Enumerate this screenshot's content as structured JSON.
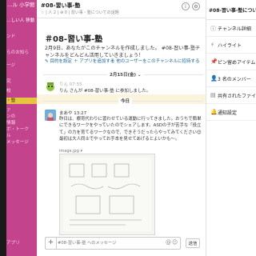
{
  "sidebar": {
    "workspace": "…ル 小学館 ",
    "items": [
      "…しい人 移動",
      "ンド",
      "らのお知ら",
      "ージ",
      "究",
      "校",
      "・塾",
      "ァ",
      "ンの",
      "情報",
      "ボ・トーク",
      "ル",
      "メッセージ",
      "",
      "",
      "",
      "",
      "アプリ"
    ]
  },
  "channel": {
    "name": "#08-習い事-塾",
    "meta": "☆ | 人 2 | ⊕ 0 | 習い事・塾についての話題"
  },
  "intro": {
    "title": "＃08-習い事-塾",
    "text": "2月9日、あなたがこのチャンネルを作成しました。 #08-習い事-塾チャンネルをどんどん活用していきましょう！",
    "link_purpose": "✎ 目的を設定",
    "link_app": "＋ アプリを追加する",
    "link_invite": "＋ 他のユーザーをこのチャンネルに招待する"
  },
  "messages": {
    "date1": "2月15日(金) ⌄",
    "join_name": "りん 07:55",
    "join_text": "りん さんが #08-習い事-塾 に参加しました。",
    "date2": "今日",
    "post_author": "まあや 13:27",
    "post_body": "昨日は、療育代わりに習わせている運動に行ってきました。おうちで簡単にできるワークをやっていたのでシェアします。ASDの子が苦手な「役立て」の力を育てるワークなので、できそうだったらやってみてください😊 最初は大人同士でやってお手本を見せてあげるとよいかも〜。",
    "image_name": "image.jpg ▾"
  },
  "input": {
    "placeholder": "#08-習い事-塾 へのメッセージ",
    "send": "送信"
  },
  "panel": {
    "title": "#08-習い事-塾について",
    "items": [
      {
        "icon": "ⓘ",
        "label": "チャンネル詳細"
      },
      {
        "icon": "⚡",
        "label": "ハイライト"
      },
      {
        "icon": "📌",
        "label": "ピン留めアイテム"
      },
      {
        "icon": "👤",
        "label": "3 名のメンバー"
      },
      {
        "icon": "▤",
        "label": "共有されたファイル"
      },
      {
        "icon": "🔔",
        "label": "通知設定"
      }
    ]
  }
}
